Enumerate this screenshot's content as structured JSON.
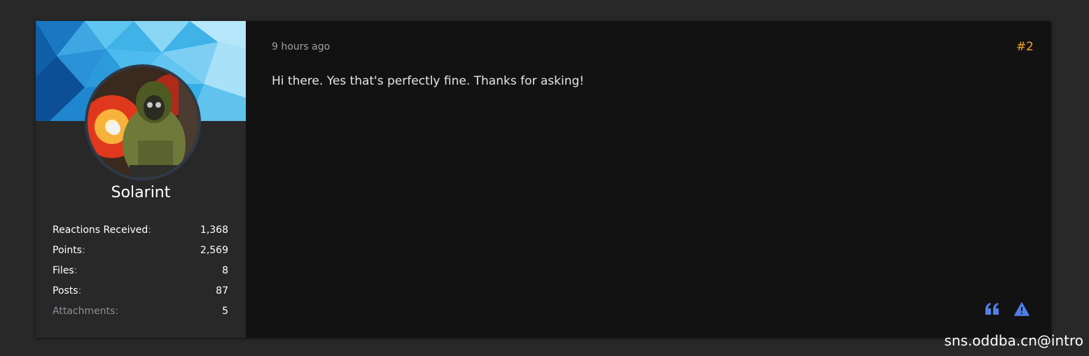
{
  "post": {
    "time": "9 hours ago",
    "number": "#2",
    "message": "Hi there. Yes that's perfectly fine. Thanks for asking!"
  },
  "author": {
    "username": "Solarint",
    "stats": [
      {
        "label": "Reactions Received",
        "sep": ":",
        "value": "1,368"
      },
      {
        "label": "Points",
        "sep": ":",
        "value": "2,569"
      },
      {
        "label": "Files",
        "sep": ":",
        "value": "8"
      },
      {
        "label": "Posts",
        "sep": ":",
        "value": "87"
      },
      {
        "label": "Attachments",
        "sep": ":",
        "value": "5"
      }
    ]
  },
  "actions": {
    "quote_icon": "quote-icon",
    "report_icon": "warning-triangle-icon"
  },
  "watermark": "sns.oddba.cn@intro",
  "colors": {
    "page_bg": "#282828",
    "post_bg": "#121212",
    "sidebar_bg": "#282828",
    "accent_number": "#f2a524",
    "action_blue": "#4f7fe6"
  }
}
